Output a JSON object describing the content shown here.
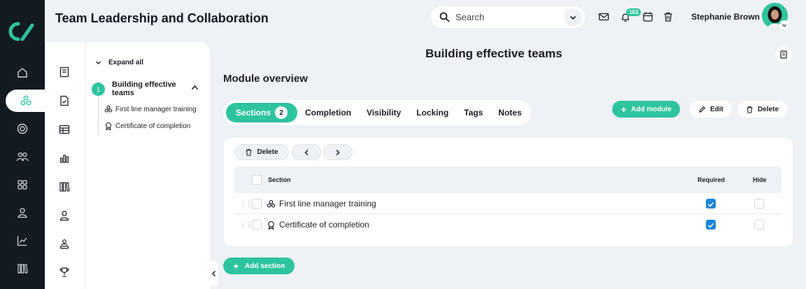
{
  "header": {
    "title": "Team Leadership and Collaboration",
    "search_placeholder": "Search",
    "notification_count": "163",
    "user_name": "Stephanie Brown"
  },
  "colors": {
    "accent": "#2ec4a0",
    "rail": "#141a22",
    "checkbox": "#1b86d8"
  },
  "rail": {
    "items": [
      "home-icon",
      "modules-icon",
      "target-icon",
      "users-icon",
      "apps-icon",
      "person-icon",
      "analytics-icon",
      "library-icon"
    ],
    "active": "modules-icon"
  },
  "panel": {
    "icons": [
      "book-icon",
      "file-check-icon",
      "table-icon",
      "chart-icon",
      "library-icon",
      "person-icon",
      "org-icon",
      "trophy-icon"
    ],
    "expand_all": "Expand all",
    "module": {
      "step": "1",
      "title": "Building effective teams",
      "sections": [
        "First line manager training",
        "Certificate of completion"
      ]
    }
  },
  "main": {
    "page_title": "Building effective teams",
    "overview_heading": "Module overview",
    "tabs": [
      {
        "label": "Sections",
        "count": "2"
      },
      {
        "label": "Completion"
      },
      {
        "label": "Visibility"
      },
      {
        "label": "Locking"
      },
      {
        "label": "Tags"
      },
      {
        "label": "Notes"
      }
    ],
    "actions": {
      "add_module": "Add module",
      "edit": "Edit",
      "delete": "Delete"
    },
    "toolbar": {
      "delete": "Delete"
    },
    "table": {
      "columns": [
        "Section",
        "Required",
        "Hide"
      ],
      "rows": [
        {
          "name": "First line manager training",
          "required": true,
          "hide": false
        },
        {
          "name": "Certificate of completion",
          "required": true,
          "hide": false
        }
      ]
    },
    "add_section": "Add section"
  }
}
